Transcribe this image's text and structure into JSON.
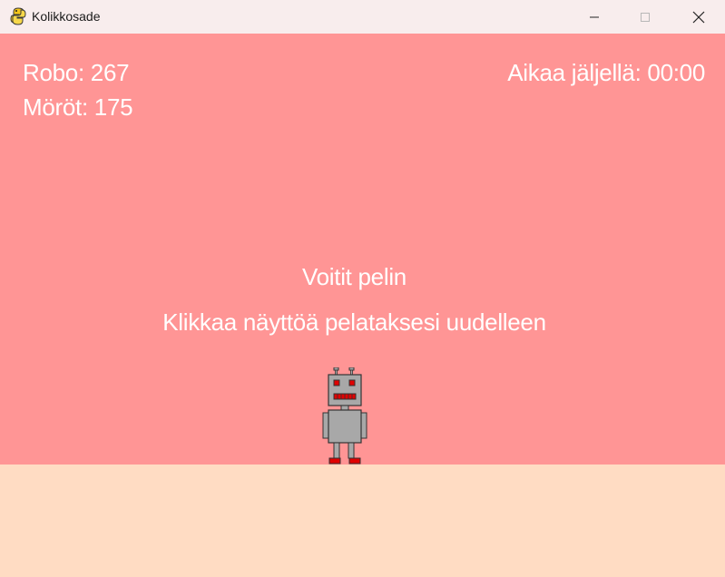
{
  "window": {
    "title": "Kolikkosade",
    "icon": "python-snake-icon"
  },
  "hud": {
    "robo_score": "Robo: 267",
    "morot_score": "Möröt: 175",
    "time_left": "Aikaa jäljellä: 00:00"
  },
  "message": {
    "result": "Voitit pelin",
    "restart_hint": "Klikkaa näyttöä pelataksesi uudelleen"
  },
  "colors": {
    "sky": "#ff9595",
    "ground": "#ffdcc3",
    "text": "#ffffff",
    "robot_body": "#a8a8a8",
    "robot_accent": "#e00000"
  }
}
